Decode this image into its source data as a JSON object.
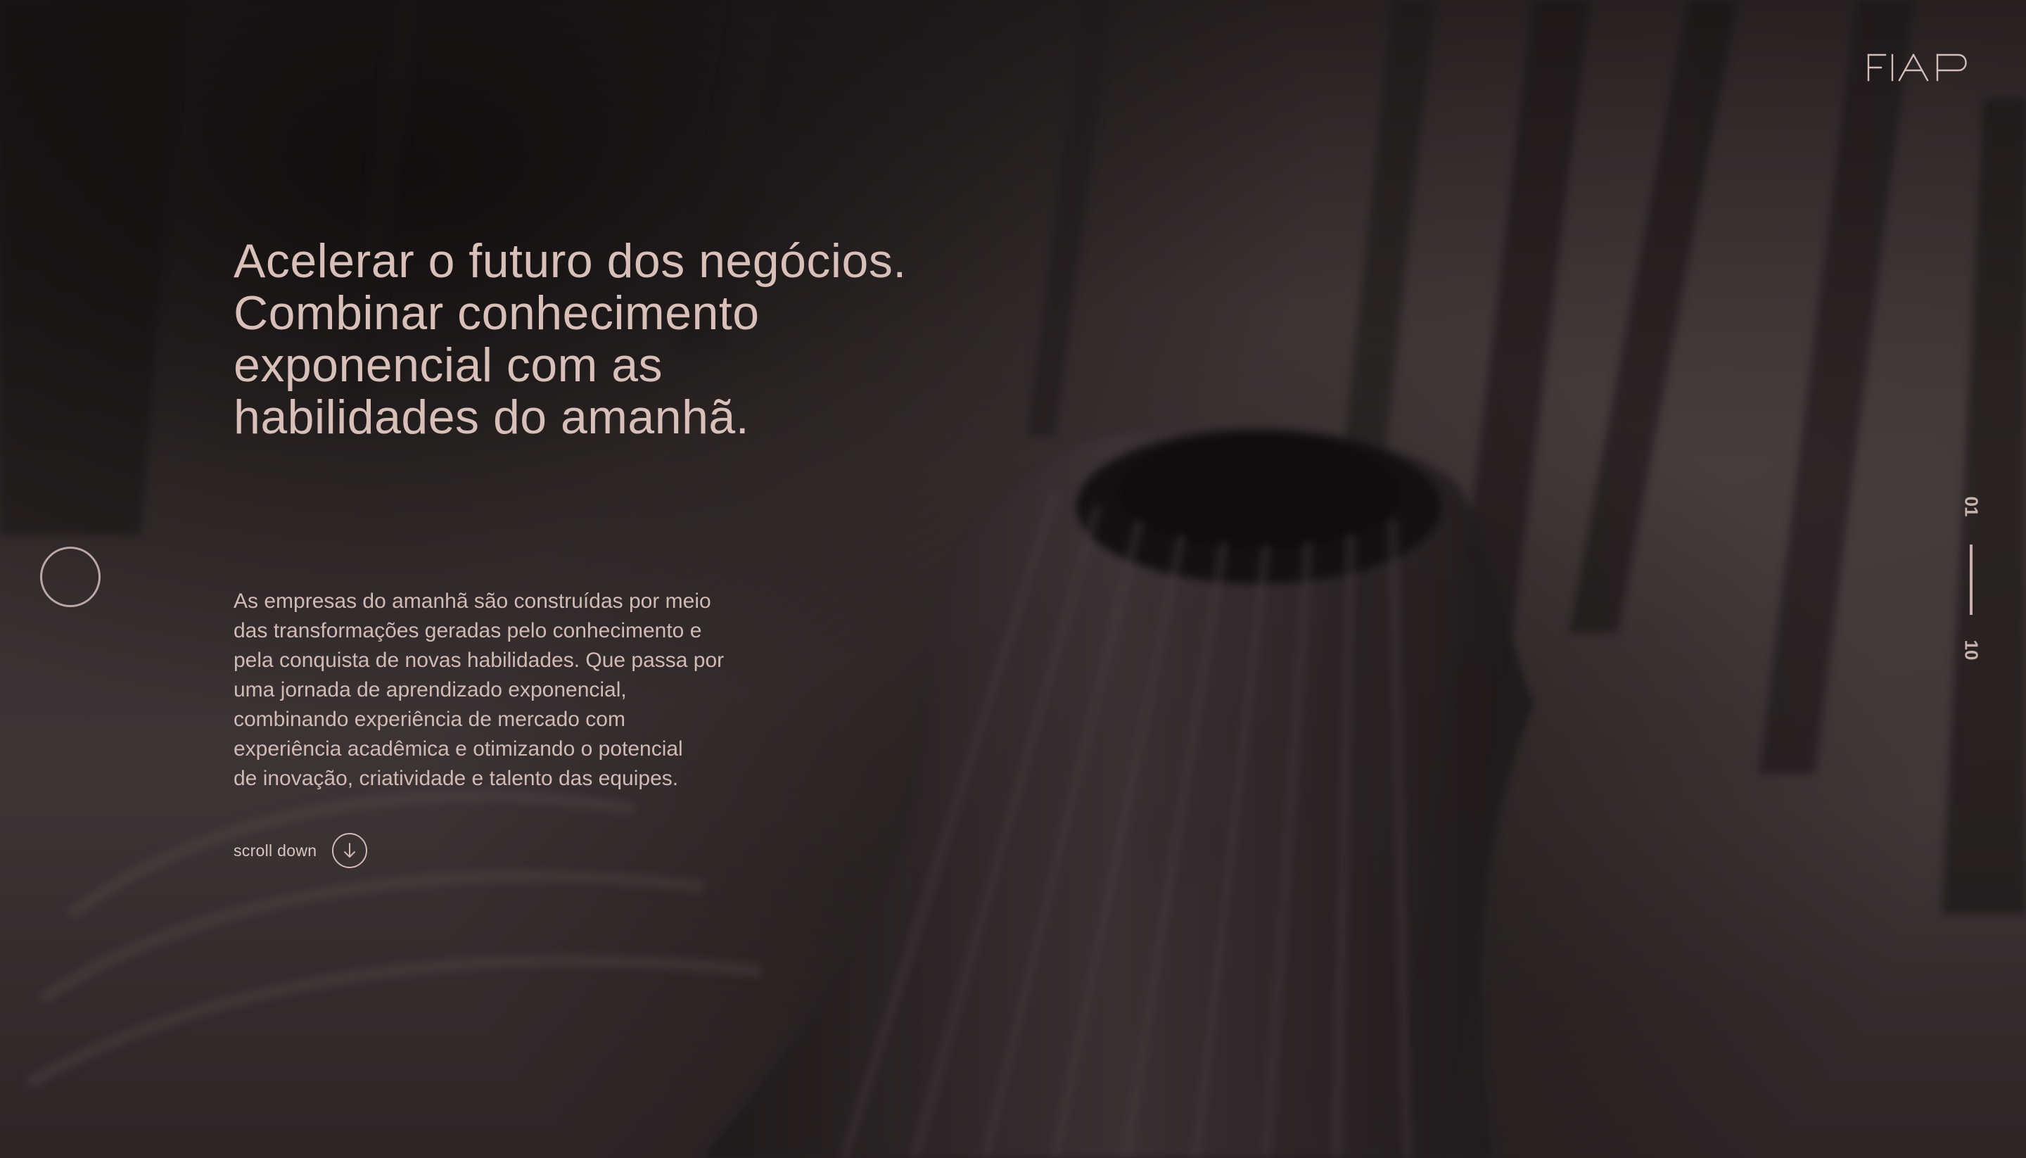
{
  "brand": {
    "logo_text": "FIAP"
  },
  "hero": {
    "headline_lines": [
      "Acelerar o futuro dos negócios.",
      "Combinar conhecimento",
      "exponencial com as",
      "habilidades do amanhã."
    ],
    "body_lines": [
      "As empresas do amanhã são construídas por meio",
      "das transformações geradas pelo conhecimento e",
      "pela conquista de novas habilidades. Que passa por",
      "uma jornada de aprendizado exponencial,",
      "combinando experiência de mercado com",
      "experiência acadêmica e otimizando o potencial",
      "de inovação, criatividade e talento das equipes."
    ]
  },
  "scroll": {
    "label": "scroll down",
    "icon": "arrow-down-icon"
  },
  "pager": {
    "current": "01",
    "total": "10"
  },
  "colors": {
    "text": "#d8bfb8",
    "background": "#2a2424",
    "accent": "#c9b2ac"
  }
}
